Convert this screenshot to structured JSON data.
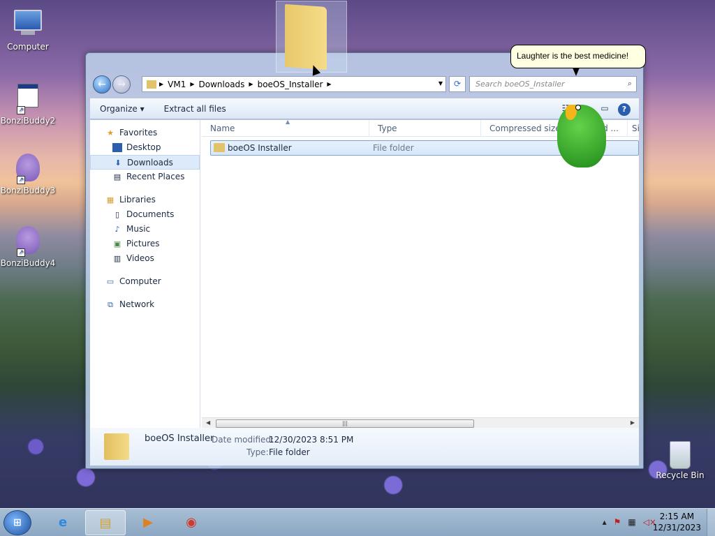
{
  "desktop": {
    "icons": [
      {
        "label": "Computer"
      },
      {
        "label": "BonziBuddy2"
      },
      {
        "label": "BonziBuddy3"
      },
      {
        "label": "BonziBuddy4"
      },
      {
        "label": "Recycle Bin"
      }
    ]
  },
  "explorer": {
    "breadcrumb": [
      "VM1",
      "Downloads",
      "boeOS_Installer"
    ],
    "search_placeholder": "Search boeOS_Installer",
    "toolbar": {
      "organize": "Organize",
      "extract": "Extract all files"
    },
    "nav": {
      "favorites": "Favorites",
      "desktop": "Desktop",
      "downloads": "Downloads",
      "recent": "Recent Places",
      "libraries": "Libraries",
      "documents": "Documents",
      "music": "Music",
      "pictures": "Pictures",
      "videos": "Videos",
      "computer": "Computer",
      "network": "Network"
    },
    "columns": {
      "name": "Name",
      "type": "Type",
      "compressed": "Compressed size",
      "password": "ord ...",
      "size": "Si"
    },
    "files": [
      {
        "name": "boeOS Installer",
        "type": "File folder"
      }
    ],
    "details": {
      "name": "boeOS Installer",
      "date_label": "Date modified:",
      "date_value": "12/30/2023 8:51 PM",
      "type_label": "Type:",
      "type_value": "File folder"
    }
  },
  "bonzi": {
    "speech": "Laughter is the best medicine!"
  },
  "taskbar": {
    "time": "2:15 AM",
    "date": "12/31/2023"
  }
}
